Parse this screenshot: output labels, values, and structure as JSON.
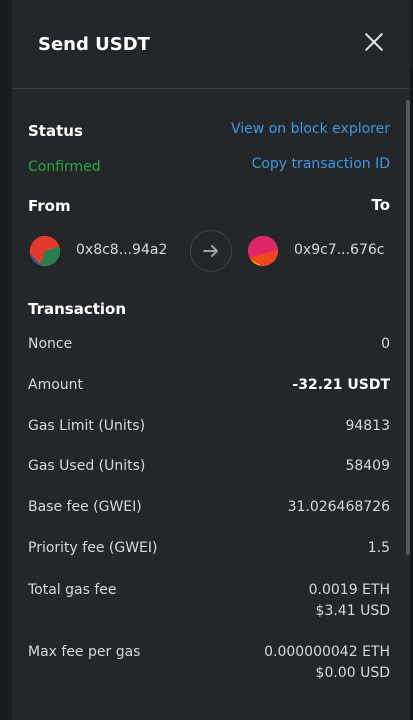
{
  "modal": {
    "title": "Send USDT"
  },
  "status": {
    "label": "Status",
    "value": "Confirmed",
    "view_explorer": "View on block explorer",
    "copy_tx_id": "Copy transaction ID"
  },
  "parties": {
    "from_label": "From",
    "to_label": "To",
    "from_address": "0x8c8...94a2",
    "to_address": "0x9c7...676c"
  },
  "transaction": {
    "title": "Transaction",
    "rows": [
      {
        "label": "Nonce",
        "value": "0"
      },
      {
        "label": "Amount",
        "value": "-32.21 USDT"
      },
      {
        "label": "Gas Limit (Units)",
        "value": "94813"
      },
      {
        "label": "Gas Used (Units)",
        "value": "58409"
      },
      {
        "label": "Base fee (GWEI)",
        "value": "31.026468726"
      },
      {
        "label": "Priority fee (GWEI)",
        "value": "1.5"
      }
    ],
    "total_gas_fee": {
      "label": "Total gas fee",
      "eth": "0.0019 ETH",
      "usd": "$3.41 USD"
    },
    "max_fee_per_gas": {
      "label": "Max fee per gas",
      "eth": "0.000000042 ETH",
      "usd": "$0.00 USD"
    }
  },
  "colors": {
    "accent_link": "#3b9ae1",
    "status_confirmed": "#28a745",
    "modal_bg": "#24272a"
  }
}
